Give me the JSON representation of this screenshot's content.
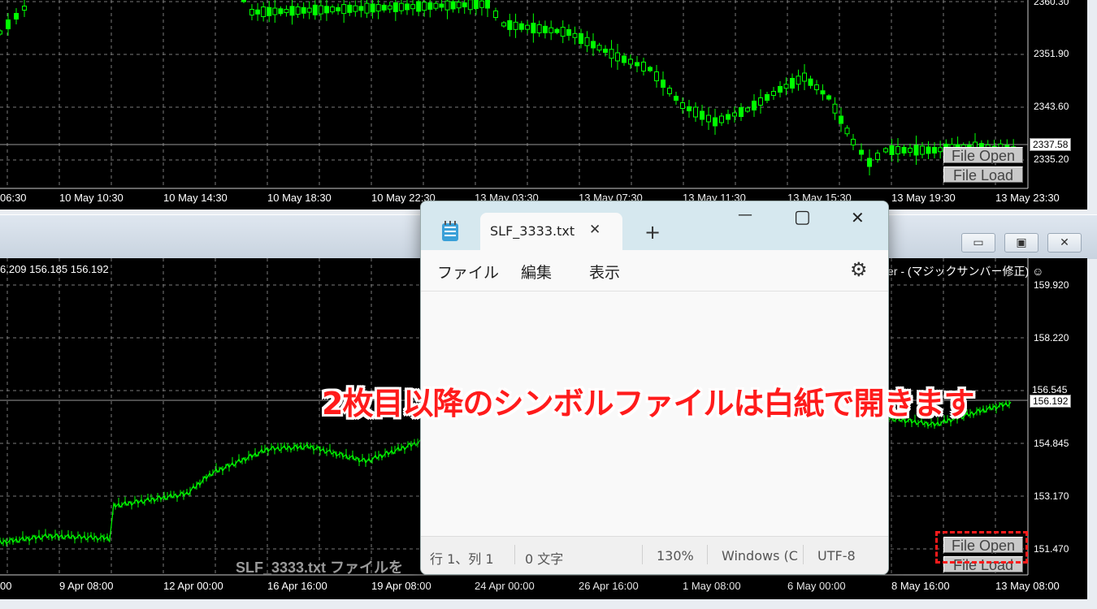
{
  "top_chart": {
    "price_labels": [
      "2360.30",
      "2351.90",
      "2343.60",
      "2335.20"
    ],
    "current_price": "2337.58",
    "time_labels": [
      "06:30",
      "10 May 10:30",
      "10 May 14:30",
      "10 May 18:30",
      "10 May 22:30",
      "13 May 03:30",
      "13 May 07:30",
      "13 May 11:30",
      "13 May 15:30",
      "13 May 19:30",
      "13 May 23:30"
    ],
    "file_open_label": "File Open",
    "file_load_label": "File Load"
  },
  "bottom_chart": {
    "ohlc_text": "6.209 156.185 156.192",
    "indicator_text": "er - (マジックサンバー修正) ☺",
    "price_labels": [
      "159.920",
      "158.220",
      "156.545",
      "154.845",
      "153.170",
      "151.470"
    ],
    "current_price": "156.192",
    "time_labels": [
      "00",
      "9 Apr 08:00",
      "12 Apr 00:00",
      "16 Apr 16:00",
      "19 Apr 08:00",
      "24 Apr 00:00",
      "26 Apr 16:00",
      "1 May 08:00",
      "6 May 00:00",
      "8 May 16:00",
      "13 May 08:00"
    ],
    "file_open_label": "File Open",
    "file_load_label": "File Load",
    "status_message": "SLF_3333.txt ファイルを"
  },
  "window_controls": {
    "minimize": "▭",
    "restore": "▣",
    "close": "✕"
  },
  "notepad": {
    "tab_title": "SLF_3333.txt",
    "tab_close": "✕",
    "new_tab": "+",
    "window_buttons": {
      "minimize": "—",
      "maximize": "▢",
      "close": "✕"
    },
    "menu": [
      "ファイル",
      "編集",
      "表示"
    ],
    "settings_icon": "⚙",
    "status": {
      "position": "行 1、列 1",
      "chars": "0 文字",
      "zoom": "130%",
      "line_ending": "Windows (C",
      "encoding": "UTF-8"
    }
  },
  "annotation": "2枚目以降のシンボルファイルは白紙で開きます",
  "colors": {
    "candle": "#00ff00",
    "annotation": "#ff1b1b",
    "grid": "#7a7a7a"
  }
}
